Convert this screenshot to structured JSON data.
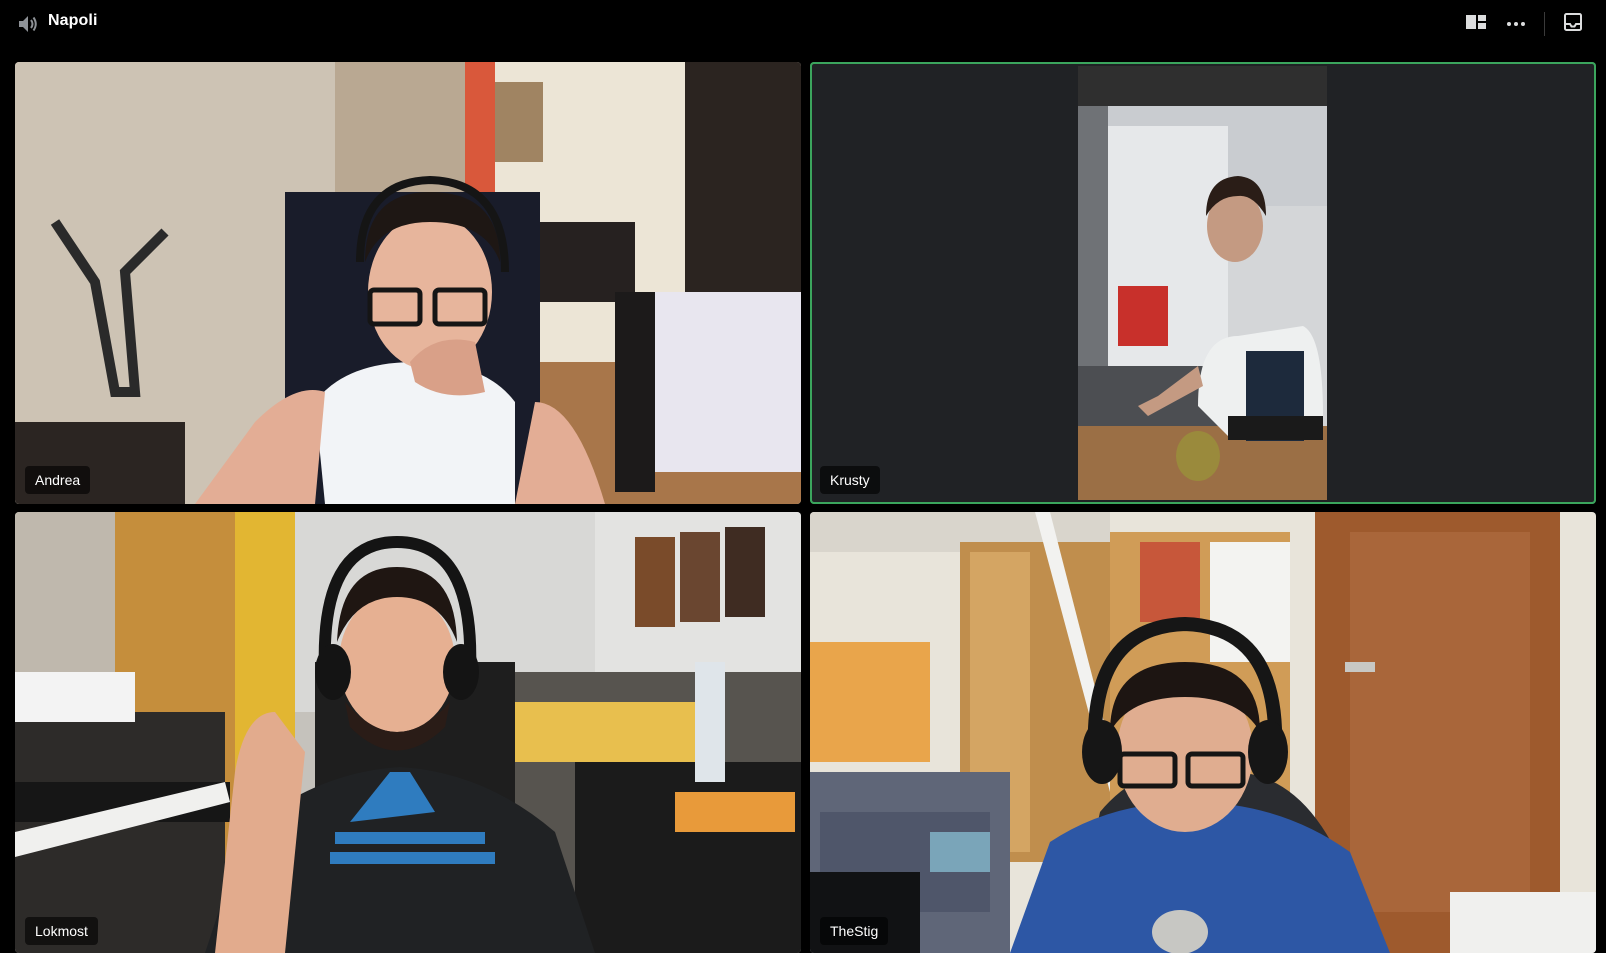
{
  "header": {
    "title": "Napoli",
    "icons": {
      "speaker": "speaker-icon",
      "layout": "grid-layout-icon",
      "more": "more-options-icon",
      "inbox": "inbox-icon"
    }
  },
  "participants": [
    {
      "name": "Andrea"
    },
    {
      "name": "Krusty",
      "speaking": true
    },
    {
      "name": "Lokmost"
    },
    {
      "name": "TheStig"
    }
  ],
  "colors": {
    "background": "#000000",
    "tile_background": "#202225",
    "speaking_border": "#3ba55d",
    "text": "#ffffff"
  }
}
